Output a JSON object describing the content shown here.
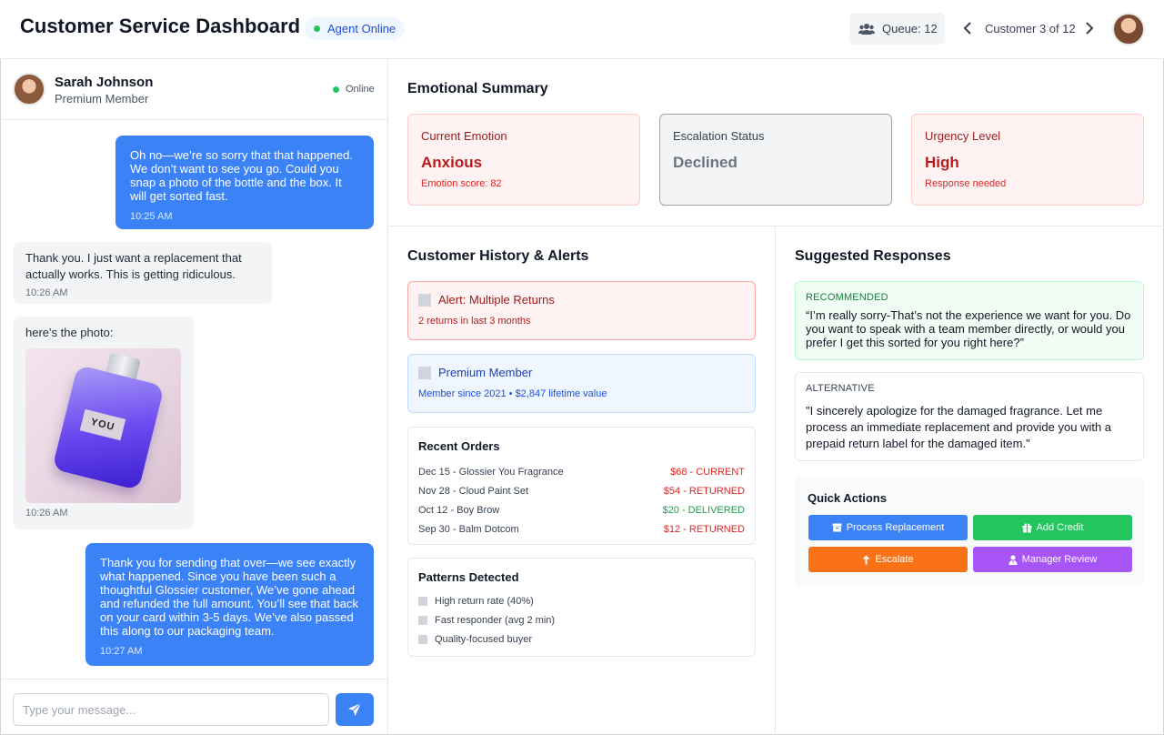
{
  "header": {
    "title": "Customer Service Dashboard",
    "agent_status": "Agent Online",
    "queue_label": "Queue: 12",
    "nav_label": "Customer 3 of 12"
  },
  "customer": {
    "name": "Sarah Johnson",
    "tier": "Premium Member",
    "status": "Online"
  },
  "messages": [
    {
      "from": "agent",
      "text": "Oh no—we’re so sorry that that happened. We don’t want to see you go. Could you snap a photo of the bottle and the box. It will get sorted fast.",
      "time": "10:25 AM"
    },
    {
      "from": "customer",
      "text": "Thank you. I just want a replacement that actually works. This is getting ridiculous.",
      "time": "10:26 AM"
    },
    {
      "from": "customer",
      "text": "here's the photo:",
      "time": "10:26 AM",
      "photo_label": "YOU"
    },
    {
      "from": "agent",
      "text": "Thank you for sending that over—we see exactly what happened. Since you have been such a thoughtful Glossier customer, We’ve gone ahead and refunded the full amount. You’ll see that back on your card within 3-5 days. We’ve also passed this along to our packaging team.",
      "time": "10:27 AM"
    }
  ],
  "composer": {
    "placeholder": "Type your message..."
  },
  "emotional_summary": {
    "title": "Emotional Summary",
    "cards": [
      {
        "label": "Current Emotion",
        "value": "Anxious",
        "sub": "Emotion score: 82"
      },
      {
        "label": "Escalation Status",
        "value": "Declined",
        "sub": ""
      },
      {
        "label": "Urgency Level",
        "value": "High",
        "sub": "Response needed"
      }
    ]
  },
  "history": {
    "title": "Customer History & Alerts",
    "alerts": [
      {
        "title": "Alert: Multiple Returns",
        "sub": "2 returns in last 3 months"
      },
      {
        "title": "Premium Member",
        "sub": "Member since 2021 • $2,847 lifetime value"
      }
    ],
    "orders_title": "Recent Orders",
    "orders": [
      {
        "item": "Dec 15 - Glossier You Fragrance",
        "status": "$68 - CURRENT",
        "color": "#dc2626"
      },
      {
        "item": "Nov 28 - Cloud Paint Set",
        "status": "$54 - RETURNED",
        "color": "#dc2626"
      },
      {
        "item": "Oct 12 - Boy Brow",
        "status": "$20 - DELIVERED",
        "color": "#16a34a"
      },
      {
        "item": "Sep 30 - Balm Dotcom",
        "status": "$12 - RETURNED",
        "color": "#dc2626"
      }
    ],
    "patterns_title": "Patterns Detected",
    "patterns": [
      "High return rate (40%)",
      "Fast responder (avg 2 min)",
      "Quality-focused buyer"
    ]
  },
  "suggestions": {
    "title": "Suggested Responses",
    "items": [
      {
        "tag": "RECOMMENDED",
        "text": "“I’m really sorry-That’s not the experience we want for you. Do you want to speak with a team member directly, or would you prefer I get this sorted for you right here?”"
      },
      {
        "tag": "ALTERNATIVE",
        "text": "\"I sincerely apologize for the damaged fragrance. Let me process an immediate replacement and provide you with a prepaid return label for the damaged item.\""
      }
    ]
  },
  "quick_actions": {
    "title": "Quick Actions",
    "buttons": [
      {
        "label": "Process Replacement",
        "icon": "box-icon",
        "color": "#3b82f6"
      },
      {
        "label": "Add Credit",
        "icon": "gift-icon",
        "color": "#22c55e"
      },
      {
        "label": "Escalate",
        "icon": "arrow-up-icon",
        "color": "#f97316"
      },
      {
        "label": "Manager Review",
        "icon": "user-tie-icon",
        "color": "#a855f7"
      }
    ]
  }
}
